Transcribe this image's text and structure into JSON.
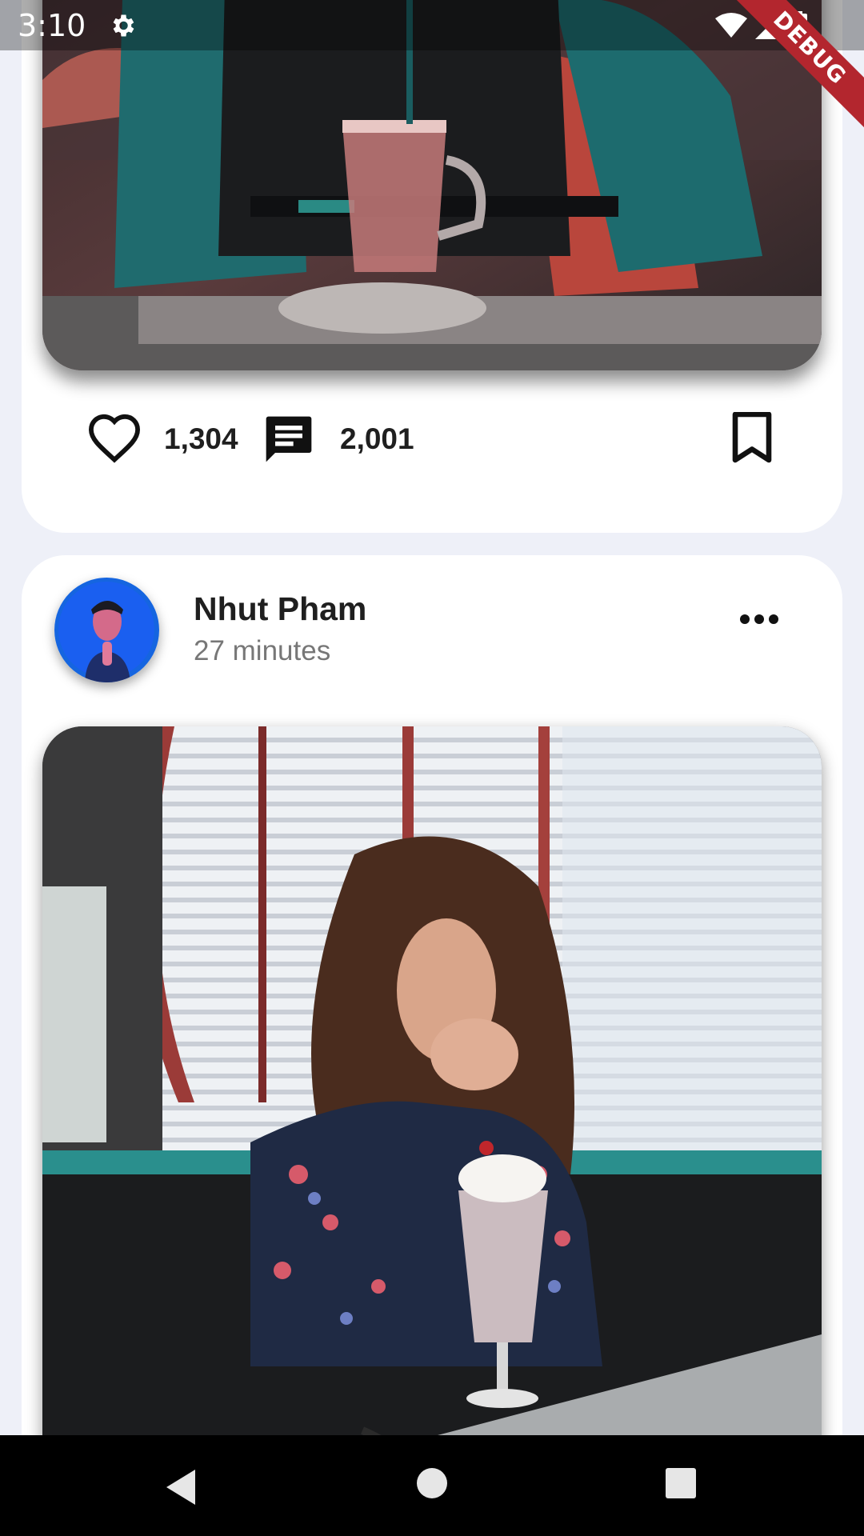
{
  "status_bar": {
    "time": "3:10",
    "icons": [
      "gear-icon",
      "wifi-icon",
      "signal-icon",
      "battery-icon"
    ],
    "debug_label": "DEBUG"
  },
  "post1": {
    "likes": "1,304",
    "comments": "2,001",
    "icons": [
      "heart-icon",
      "comment-icon",
      "bookmark-icon"
    ]
  },
  "post2": {
    "author": "Nhut Pham",
    "time": "27 minutes",
    "icons": [
      "more-icon"
    ]
  },
  "nav": {
    "icons": [
      "back-icon",
      "home-icon",
      "recents-icon"
    ]
  },
  "colors": {
    "background": "#eef0f8",
    "card": "#ffffff",
    "text": "#1f1f1f",
    "muted": "#777777",
    "debug": "#b3262e"
  }
}
